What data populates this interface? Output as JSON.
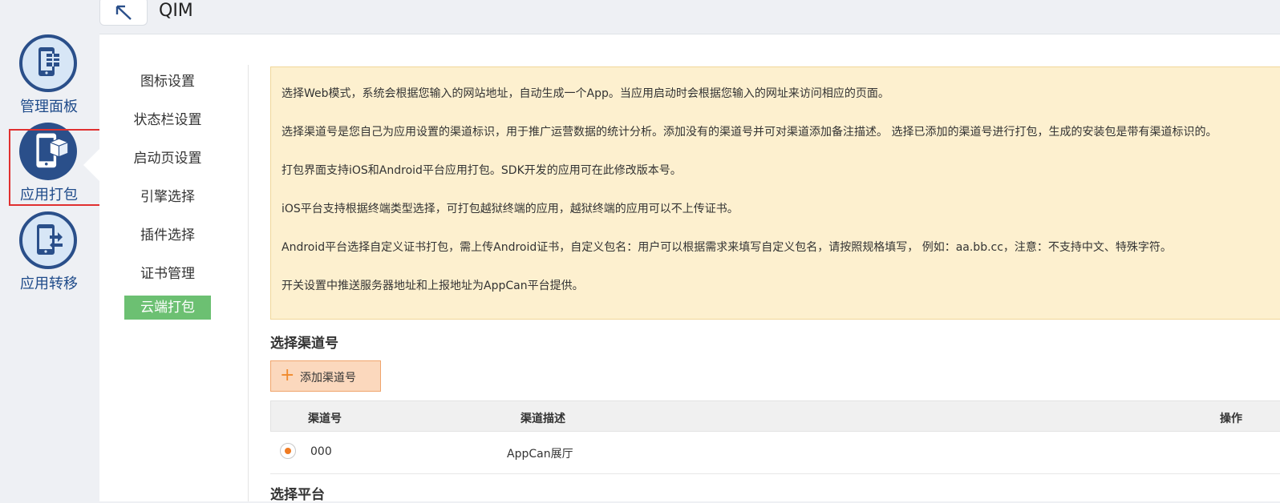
{
  "rail": {
    "items": [
      {
        "label": "管理面板",
        "icon": "dashboard-phone-icon"
      },
      {
        "label": "应用打包",
        "icon": "package-phone-icon"
      },
      {
        "label": "应用转移",
        "icon": "transfer-phone-icon"
      }
    ],
    "highlight_color": "#e03030"
  },
  "header": {
    "back_icon": "arrow-up-left-icon",
    "title": "QIM"
  },
  "subnav": {
    "items": [
      "图标设置",
      "状态栏设置",
      "启动页设置",
      "引擎选择",
      "插件选择",
      "证书管理",
      "云端打包"
    ],
    "active": "云端打包",
    "active_color": "#6cc072"
  },
  "notice": {
    "lines": [
      "选择Web模式，系统会根据您输入的网站地址，自动生成一个App。当应用启动时会根据您输入的网址来访问相应的页面。",
      "选择渠道号是您自己为应用设置的渠道标识，用于推广运营数据的统计分析。添加没有的渠道号并可对渠道添加备注描述。 选择已添加的渠道号进行打包，生成的安装包是带有渠道标识的。",
      "打包界面支持iOS和Android平台应用打包。SDK开发的应用可在此修改版本号。",
      "iOS平台支持根据终端类型选择，可打包越狱终端的应用，越狱终端的应用可以不上传证书。",
      "Android平台选择自定义证书打包，需上传Android证书，自定义包名：用户可以根据需求来填写自定义包名，请按照规格填写， 例如：aa.bb.cc，注意：不支持中文、特殊字符。",
      "开关设置中推送服务器地址和上报地址为AppCan平台提供。"
    ]
  },
  "channel": {
    "section_title": "选择渠道号",
    "add_button": "添加渠道号",
    "columns": [
      "渠道号",
      "渠道描述",
      "操作"
    ],
    "rows": [
      {
        "id": "000",
        "desc": "AppCan展厅",
        "selected": true
      }
    ]
  },
  "platform": {
    "section_title": "选择平台"
  }
}
